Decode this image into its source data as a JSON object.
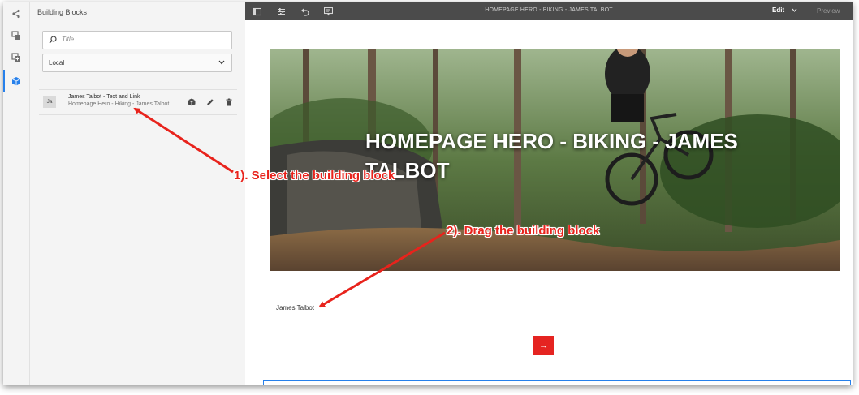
{
  "side_rail": {
    "icons": [
      "share-icon",
      "layers-icon",
      "assets-icon",
      "building-blocks-icon"
    ]
  },
  "panel": {
    "title": "Building Blocks",
    "search_placeholder": "Title",
    "filter_value": "Local",
    "items": [
      {
        "avatar": "Ja",
        "title": "James Talbot - Text and Link",
        "subtitle": "Homepage Hero - Hiking - James Talbot..."
      }
    ]
  },
  "toolbar": {
    "page_title": "HOMEPAGE HERO - BIKING - JAMES TALBOT",
    "mode_label": "Edit",
    "preview_label": "Preview"
  },
  "page": {
    "hero_title": "HOMEPAGE HERO - BIKING - JAMES TALBOT",
    "body_text": "James Talbot",
    "cta_glyph": "→"
  },
  "annotations": {
    "step1": "1). Select the building block",
    "step2": "2). Drag the building block"
  },
  "colors": {
    "accent": "#2680eb",
    "annotation": "#e8231c",
    "cta": "#e52421",
    "toolbar": "#4b4b4b"
  }
}
